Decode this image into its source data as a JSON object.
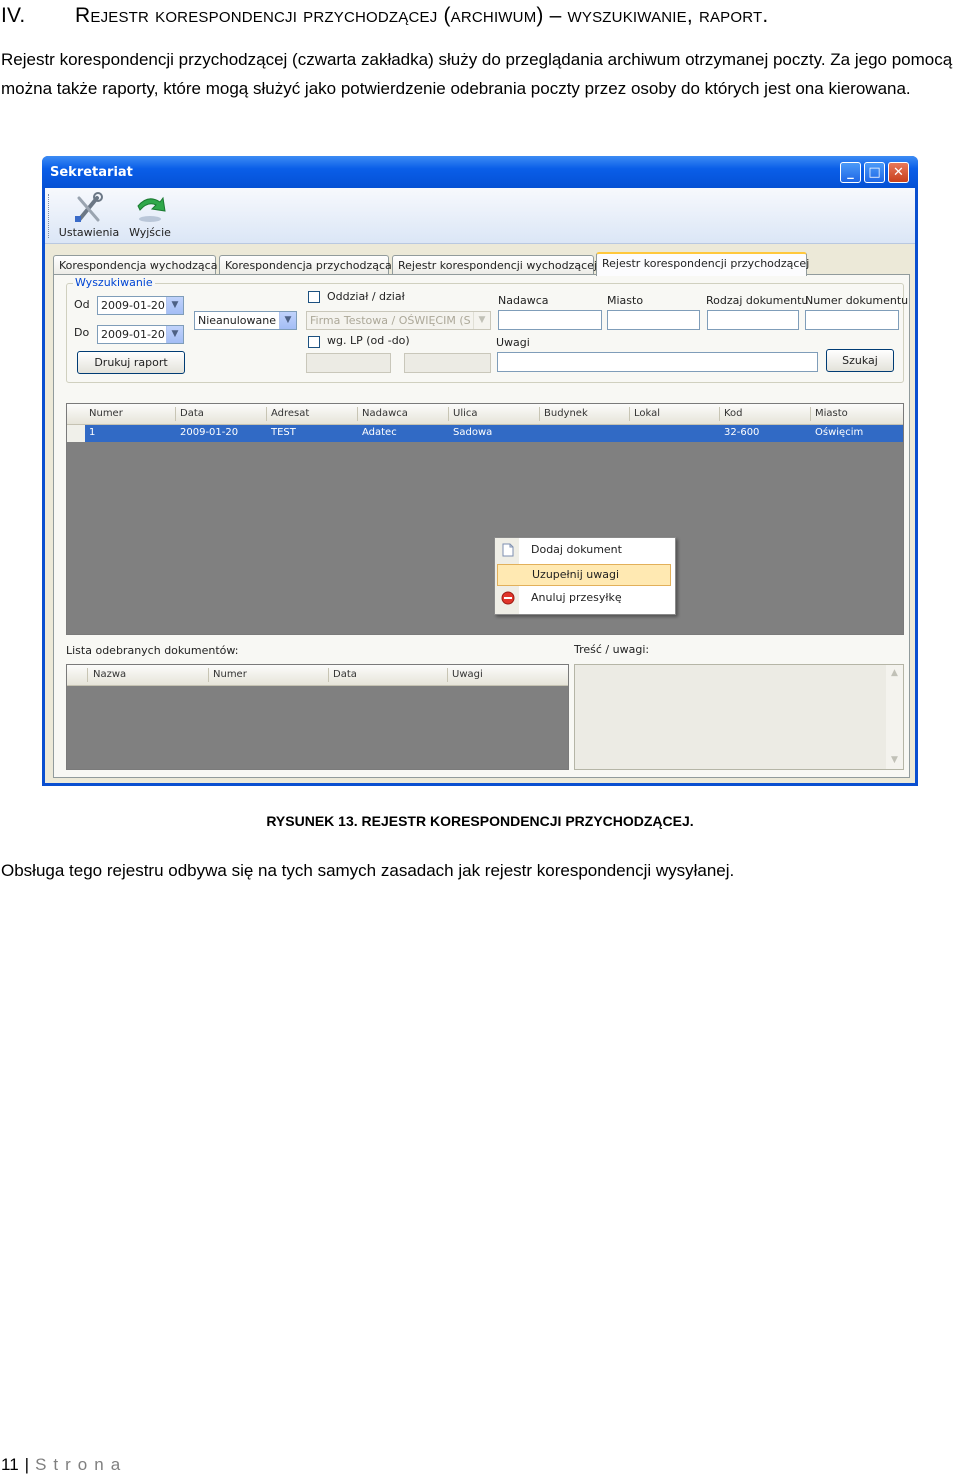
{
  "heading": {
    "number": "IV.",
    "title": "Rejestr korespondencji przychodzącej (archiwum) – wyszukiwanie, raport."
  },
  "intro": "Rejestr korespondencji przychodzącej (czwarta zakładka) służy do przeglądania archiwum otrzymanej poczty. Za jego pomocą można także raporty, które mogą służyć jako potwierdzenie odebrania poczty przez osoby do których jest ona kierowana.",
  "window": {
    "title": "Sekretariat",
    "controls": {
      "minimize": "_",
      "maximize": "□",
      "close": "✕"
    },
    "toolbar": {
      "settings_label": "Ustawienia",
      "exit_label": "Wyjście"
    },
    "tabs": [
      {
        "label": "Korespondencja wychodząca"
      },
      {
        "label": "Korespondencja przychodząca"
      },
      {
        "label": "Rejestr korespondencji wychodzącej"
      },
      {
        "label": "Rejestr korespondencji przychodzącej"
      }
    ],
    "search": {
      "legend": "Wyszukiwanie",
      "from_label": "Od",
      "from_value": "2009-01-20",
      "to_label": "Do",
      "to_value": "2009-01-20",
      "status_value": "Nieanulowane",
      "branch_label": "Oddział / dział",
      "branch_value": "Firma Testowa / OŚWIĘCIM (S",
      "lp_label": "wg. LP (od -do)",
      "sender_label": "Nadawca",
      "city_label": "Miasto",
      "doc_type_label": "Rodzaj dokumentu",
      "doc_number_label": "Numer dokumentu",
      "notes_label": "Uwagi",
      "print_button": "Drukuj raport",
      "search_button": "Szukaj"
    },
    "grid": {
      "columns": [
        "Numer",
        "Data",
        "Adresat",
        "Nadawca",
        "Ulica",
        "Budynek",
        "Lokal",
        "Kod",
        "Miasto"
      ],
      "rows": [
        [
          "1",
          "2009-01-20",
          "TEST",
          "Adatec",
          "Sadowa",
          "",
          "",
          "32-600",
          "Oświęcim"
        ]
      ]
    },
    "context_menu": [
      {
        "label": "Dodaj dokument",
        "icon": "document-icon"
      },
      {
        "label": "Uzupełnij uwagi",
        "icon": "none"
      },
      {
        "label": "Anuluj przesyłkę",
        "icon": "cancel-icon"
      }
    ],
    "received_list": {
      "label": "Lista odebranych dokumentów:",
      "columns": [
        "Nazwa",
        "Numer",
        "Data",
        "Uwagi"
      ]
    },
    "content_label": "Treść / uwagi:"
  },
  "caption": "Rysunek 13. Rejestr korespondencji przychodzącej.",
  "outro": "Obsługa tego rejestru odbywa się na tych samych zasadach jak rejestr korespondencji wysyłanej.",
  "footer": {
    "page": "11",
    "separator": "|",
    "word": "Strona"
  },
  "colors": {
    "title_bar": "#0a5ee8",
    "selected_row": "#316ac5",
    "menu_hover": "#ffe9b2",
    "grid_background": "#808080"
  }
}
